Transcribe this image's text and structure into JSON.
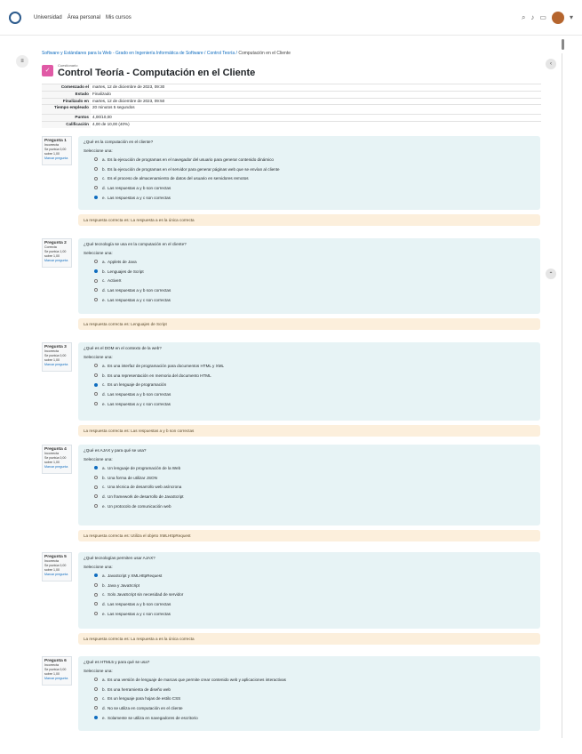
{
  "topbar": {
    "nav": [
      "Universidad",
      "Área personal",
      "Mis cursos"
    ],
    "icons": [
      "search-icon",
      "bell-icon",
      "chat-icon"
    ]
  },
  "breadcrumb": {
    "course": "Software y Estándares para la Web - Grado en Ingeniería Informática de Software",
    "section": "Control Teoría",
    "current": "Computación en el Cliente"
  },
  "header": {
    "sub": "Cuestionario",
    "title": "Control Teoría - Computación en el Cliente"
  },
  "summary": [
    {
      "k": "Comenzado el",
      "v": "martes, 12 de diciembre de 2023, 09:30"
    },
    {
      "k": "Estado",
      "v": "Finalizado"
    },
    {
      "k": "Finalizado en",
      "v": "martes, 12 de diciembre de 2023, 09:50"
    },
    {
      "k": "Tiempo empleado",
      "v": "20 minutos 5 segundos"
    },
    {
      "k": "Puntos",
      "v": "4,00/10,00"
    },
    {
      "k": "Calificación",
      "v": "4,00 de 10,00 (40%)"
    }
  ],
  "questions": [
    {
      "num": "Pregunta 1",
      "state": "Incorrecta",
      "mark": "Se puntúa 0,00 sobre 1,00",
      "flag": "Marcar pregunta",
      "text": "¿Qué es la computación en el cliente?",
      "prompt": "Seleccione una:",
      "options": [
        {
          "l": "a.",
          "t": "Es la ejecución de programas en el navegador del usuario para generar contenido dinámico",
          "on": false
        },
        {
          "l": "b.",
          "t": "Es la ejecución de programas en el servidor para generar páginas web que se envían al cliente",
          "on": false
        },
        {
          "l": "c.",
          "t": "Es el proceso de almacenamiento de datos del usuario en servidores remotos",
          "on": false
        },
        {
          "l": "d.",
          "t": "Las respuestas a y b son correctas",
          "on": false
        },
        {
          "l": "e.",
          "t": "Las respuestas a y c son correctas",
          "on": true
        }
      ],
      "feedback": "La respuesta correcta es: La respuesta a es la única correcta"
    },
    {
      "num": "Pregunta 2",
      "state": "Correcta",
      "mark": "Se puntúa 1,00 sobre 1,00",
      "flag": "Marcar pregunta",
      "text": "¿Qué tecnología se usa en la computación en el cliente?",
      "prompt": "Seleccione una:",
      "options": [
        {
          "l": "a.",
          "t": "Applets de Java",
          "on": false
        },
        {
          "l": "b.",
          "t": "Lenguajes de Script",
          "on": true
        },
        {
          "l": "c.",
          "t": "ActiveX",
          "on": false
        },
        {
          "l": "d.",
          "t": "Las respuestas a y b son correctas",
          "on": false
        },
        {
          "l": "e.",
          "t": "Las respuestas a y c son correctas",
          "on": false
        }
      ],
      "feedback": "La respuesta correcta es: Lenguajes de Script"
    },
    {
      "num": "Pregunta 3",
      "state": "Incorrecta",
      "mark": "Se puntúa 0,00 sobre 1,00",
      "flag": "Marcar pregunta",
      "text": "¿Qué es el DOM en el contexto de la web?",
      "prompt": "Seleccione una:",
      "options": [
        {
          "l": "a.",
          "t": "Es una interfaz de programación para documentos HTML y XML",
          "on": false
        },
        {
          "l": "b.",
          "t": "Es una representación en memoria del documento HTML",
          "on": false
        },
        {
          "l": "c.",
          "t": "Es un lenguaje de programación",
          "on": true
        },
        {
          "l": "d.",
          "t": "Las respuestas a y b son correctas",
          "on": false
        },
        {
          "l": "e.",
          "t": "Las respuestas a y c son correctas",
          "on": false
        }
      ],
      "feedback": "La respuesta correcta es: Las respuestas a y b son correctas"
    },
    {
      "num": "Pregunta 4",
      "state": "Incorrecta",
      "mark": "Se puntúa 0,00 sobre 1,00",
      "flag": "Marcar pregunta",
      "text": "¿Qué es AJAX y para qué se usa?",
      "prompt": "Seleccione una:",
      "options": [
        {
          "l": "a.",
          "t": "Un lenguaje de programación de la Web",
          "on": true
        },
        {
          "l": "b.",
          "t": "Una forma de utilizar JSON",
          "on": false
        },
        {
          "l": "c.",
          "t": "Una técnica de desarrollo web asíncrona",
          "on": false
        },
        {
          "l": "d.",
          "t": "Un framework de desarrollo de JavaScript",
          "on": false
        },
        {
          "l": "e.",
          "t": "Un protocolo de comunicación web",
          "on": false
        }
      ],
      "feedback": "La respuesta correcta es: Utiliza el objeto XMLHttpRequest"
    },
    {
      "num": "Pregunta 5",
      "state": "Incorrecta",
      "mark": "Se puntúa 0,00 sobre 1,00",
      "flag": "Marcar pregunta",
      "text": "¿Qué tecnologías permiten usar AJAX?",
      "prompt": "Seleccione una:",
      "options": [
        {
          "l": "a.",
          "t": "JavaScript y XMLHttpRequest",
          "on": true
        },
        {
          "l": "b.",
          "t": "Java y JavaScript",
          "on": false
        },
        {
          "l": "c.",
          "t": "Solo JavaScript sin necesidad de servidor",
          "on": false
        },
        {
          "l": "d.",
          "t": "Las respuestas a y b son correctas",
          "on": false
        },
        {
          "l": "e.",
          "t": "Las respuestas a y c son correctas",
          "on": false
        }
      ],
      "feedback": "La respuesta correcta es: La respuesta a es la única correcta"
    },
    {
      "num": "Pregunta 6",
      "state": "Incorrecta",
      "mark": "Se puntúa 0,00 sobre 1,00",
      "flag": "Marcar pregunta",
      "text": "¿Qué es HTML5 y para qué se usa?",
      "prompt": "Seleccione una:",
      "options": [
        {
          "l": "a.",
          "t": "Es una versión de lenguaje de marcas que permite crear contenido web y aplicaciones interactivas",
          "on": false
        },
        {
          "l": "b.",
          "t": "Es una herramienta de diseño web",
          "on": false
        },
        {
          "l": "c.",
          "t": "Es un lenguaje para hojas de estilo CSS",
          "on": false
        },
        {
          "l": "d.",
          "t": "No se utiliza en computación en el cliente",
          "on": false
        },
        {
          "l": "e.",
          "t": "Solamente se utiliza en navegadores de escritorio",
          "on": true
        }
      ]
    }
  ]
}
